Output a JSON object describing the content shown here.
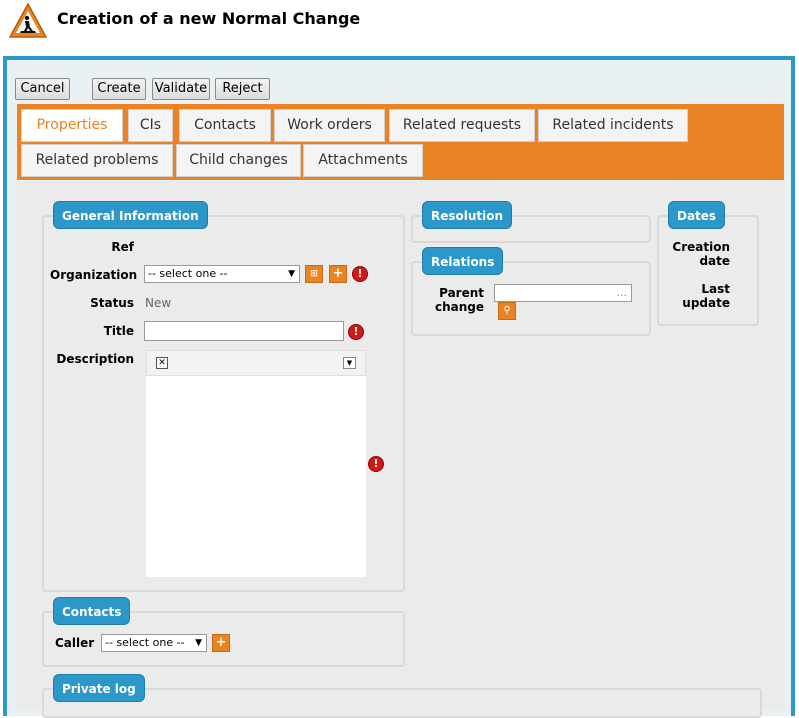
{
  "header": {
    "title": "Creation of a new Normal Change"
  },
  "toolbar": {
    "cancel": "Cancel",
    "create": "Create",
    "validate": "Validate",
    "reject": "Reject"
  },
  "tabs": [
    {
      "label": "Properties",
      "active": true
    },
    {
      "label": "CIs"
    },
    {
      "label": "Contacts"
    },
    {
      "label": "Work orders"
    },
    {
      "label": "Related requests"
    },
    {
      "label": "Related incidents"
    },
    {
      "label": "Related problems"
    },
    {
      "label": "Child changes"
    },
    {
      "label": "Attachments"
    }
  ],
  "general": {
    "legend": "General Information",
    "ref_label": "Ref",
    "org_label": "Organization",
    "org_value": "-- select one --",
    "status_label": "Status",
    "status_value": "New",
    "title_label": "Title",
    "description_label": "Description"
  },
  "resolution": {
    "legend": "Resolution"
  },
  "relations": {
    "legend": "Relations",
    "parent_label_1": "Parent",
    "parent_label_2": "change",
    "parent_value": "..."
  },
  "dates": {
    "legend": "Dates",
    "creation_1": "Creation",
    "creation_2": "date",
    "last_1": "Last",
    "last_2": "update"
  },
  "contacts": {
    "legend": "Contacts",
    "caller_label": "Caller",
    "caller_value": "-- select one --"
  },
  "private_log": {
    "legend": "Private log"
  },
  "colors": {
    "accent_orange": "#ea8323",
    "legend_blue": "#2b98c9",
    "error_red": "#d01a1a"
  }
}
